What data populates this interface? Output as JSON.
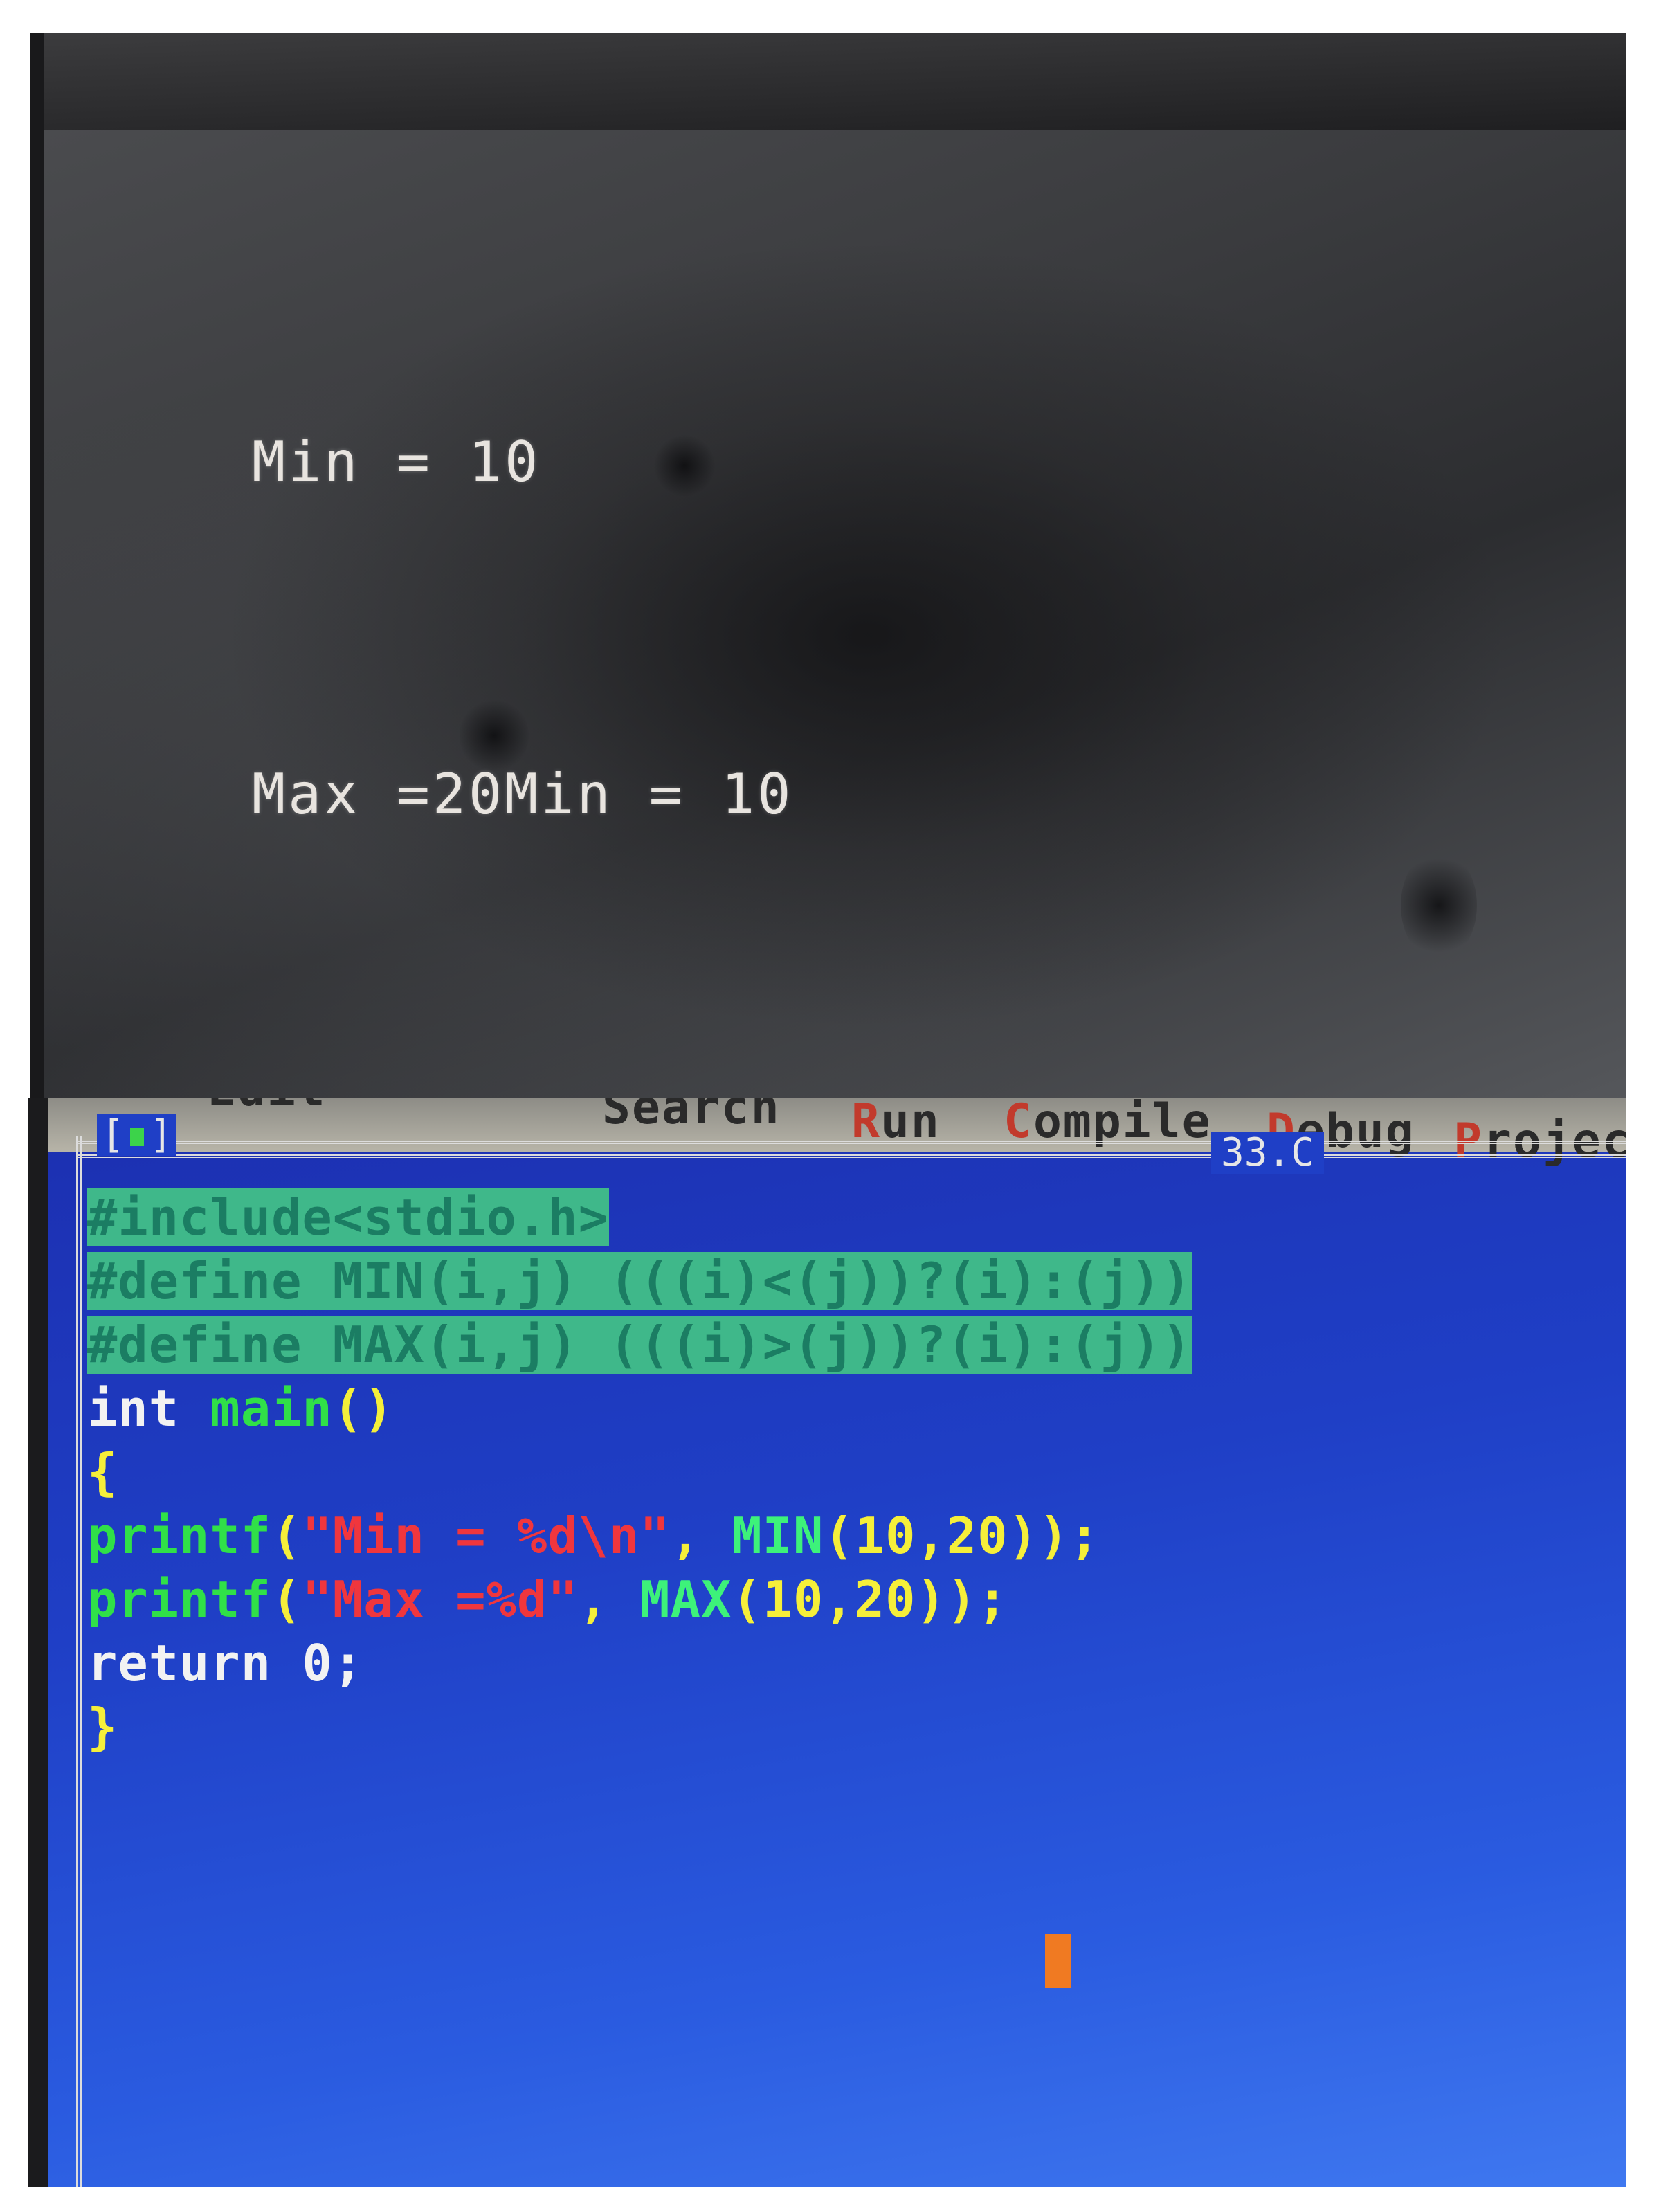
{
  "output_screen": {
    "lines": [
      "Min = 10",
      "Max =20Min = 10",
      "Max =20"
    ]
  },
  "editor": {
    "menu": [
      {
        "hot": "",
        "rest": "Edit"
      },
      {
        "hot": "",
        "rest": "Search"
      },
      {
        "hot": "R",
        "rest": "un"
      },
      {
        "hot": "C",
        "rest": "ompile"
      },
      {
        "hot": "D",
        "rest": "ebug"
      },
      {
        "hot": "P",
        "rest": "roject"
      }
    ],
    "window_button": "[■]",
    "filename": "33.C",
    "code": {
      "l1": "#include<stdio.h>",
      "l2": "#define MIN(i,j) (((i)<(j))?(i):(j))",
      "l3": "#define MAX(i,j) (((i)>(j))?(i):(j))",
      "l4_kw": "int ",
      "l4_fn": "main",
      "l4_paren": "()",
      "l5": "{",
      "l6_fn": "printf",
      "l6_open": "(",
      "l6_str": "\"Min = %d\\n\"",
      "l6_comma": ", ",
      "l6_macro": "MIN",
      "l6_args": "(10,20));",
      "l7_fn": "printf",
      "l7_open": "(",
      "l7_str": "\"Max =%d\"",
      "l7_comma": ", ",
      "l7_macro": "MAX",
      "l7_args": "(10,20));",
      "l8": "return 0;",
      "l9": "}"
    }
  }
}
